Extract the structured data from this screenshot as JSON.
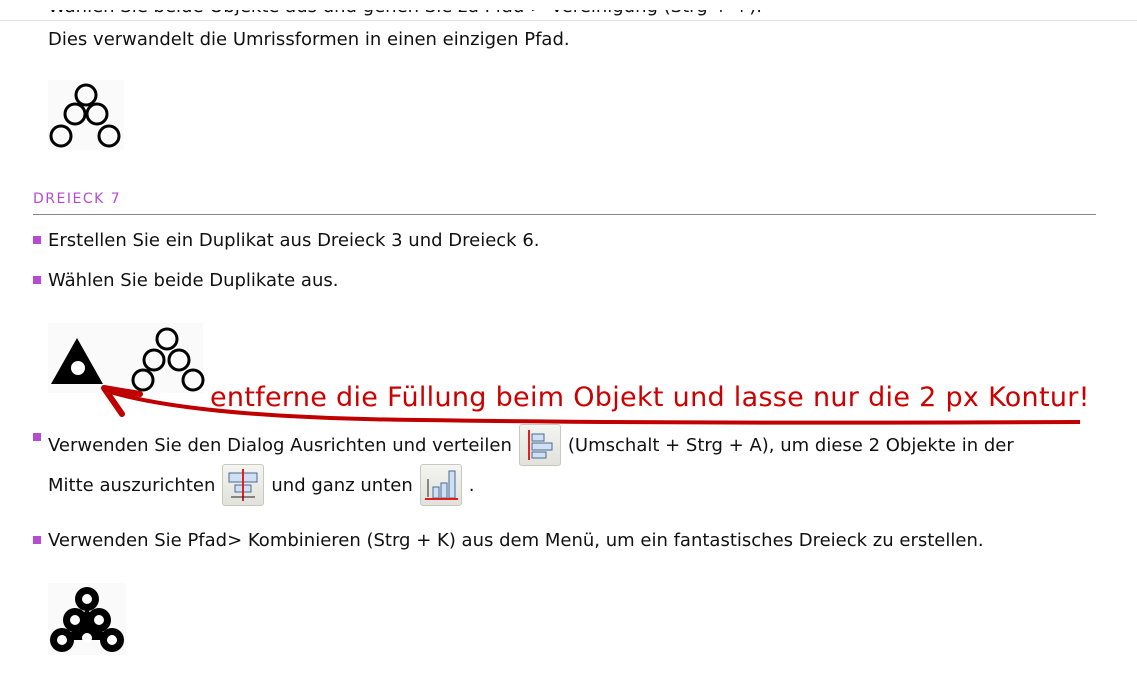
{
  "prev_text_cut": "Wählen Sie beide Objekte aus und gehen Sie zu Pfad > Vereinigung (Strg + +).",
  "prev_text": "Dies verwandelt die Umrissformen in einen einzigen Pfad.",
  "section_heading": "DREIECK 7",
  "bullets": [
    "Erstellen Sie ein Duplikat aus Dreieck 3 und Dreieck 6.",
    "Wählen Sie beide Duplikate aus."
  ],
  "annotation": "entferne die Füllung beim Objekt und lasse nur die 2 px Kontur!",
  "align_step": {
    "part1": "Verwenden Sie den Dialog Ausrichten und verteilen",
    "part2": "(Umschalt + Strg + A), um diese 2 Objekte in der",
    "part3": "Mitte auszurichten",
    "part4": "und ganz unten",
    "part5": "."
  },
  "combine_step": "Verwenden Sie Pfad> Kombinieren (Strg + K) aus dem Menü, um ein fantastisches Dreieck zu erstellen.",
  "colors": {
    "accent": "#b44bd0",
    "annotation": "#cc0000"
  }
}
